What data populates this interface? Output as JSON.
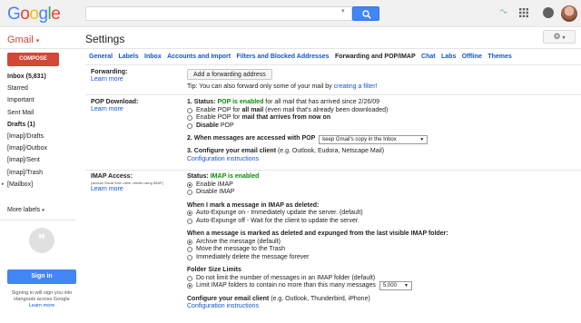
{
  "header": {
    "logo_letters": [
      {
        "ch": "G",
        "color": "#4285f4"
      },
      {
        "ch": "o",
        "color": "#ea4335"
      },
      {
        "ch": "o",
        "color": "#fbbc05"
      },
      {
        "ch": "g",
        "color": "#4285f4"
      },
      {
        "ch": "l",
        "color": "#34a853"
      },
      {
        "ch": "e",
        "color": "#ea4335"
      }
    ],
    "search": {
      "value": "",
      "placeholder": ""
    },
    "icons": [
      "apps-icon",
      "notifications-icon",
      "avatar"
    ]
  },
  "app": {
    "label": "Gmail",
    "page_title": "Settings",
    "gear_label": "⚙"
  },
  "sidebar": {
    "compose": "COMPOSE",
    "items": [
      {
        "label": "Inbox (5,831)",
        "bold": true
      },
      {
        "label": "Starred"
      },
      {
        "label": "Important"
      },
      {
        "label": "Sent Mail"
      },
      {
        "label": "Drafts (1)",
        "bold": true
      },
      {
        "label": "[Imap]/Drafts"
      },
      {
        "label": "[Imap]/Outbox"
      },
      {
        "label": "[Imap]/Sent"
      },
      {
        "label": "[Imap]/Trash"
      },
      {
        "label": "[Mailbox]",
        "arrow": true
      }
    ],
    "more_labels": "More labels",
    "hangouts_glyph": "❞",
    "signin": "Sign in",
    "signin_note": "Signing in will sign you into Hangouts across Google",
    "learn_more": "Learn more"
  },
  "tabs": [
    {
      "label": "General"
    },
    {
      "label": "Labels"
    },
    {
      "label": "Inbox"
    },
    {
      "label": "Accounts and Import"
    },
    {
      "label": "Filters and Blocked Addresses"
    },
    {
      "label": "Forwarding and POP/IMAP",
      "active": true
    },
    {
      "label": "Chat"
    },
    {
      "label": "Labs"
    },
    {
      "label": "Offline"
    },
    {
      "label": "Themes"
    }
  ],
  "forwarding": {
    "label": "Forwarding:",
    "learn_more": "Learn more",
    "button": "Add a forwarding address",
    "tip_prefix": "Tip: You can also forward only some of your mail by ",
    "tip_link": "creating a filter!"
  },
  "pop": {
    "label": "POP Download:",
    "learn_more": "Learn more",
    "status_prefix": "1. Status: ",
    "status_value": "POP is enabled",
    "status_suffix": " for all mail that has arrived since 2/26/09",
    "options": [
      {
        "pre": "Enable POP for ",
        "bold": "all mail",
        "post": " (even mail that's already been downloaded)",
        "checked": false
      },
      {
        "pre": "Enable POP for ",
        "bold": "mail that arrives from now on",
        "post": "",
        "checked": false
      },
      {
        "pre": "",
        "bold": "Disable",
        "post": " POP",
        "checked": false
      }
    ],
    "step2": "2. When messages are accessed with POP",
    "step2_select": "keep Gmail's copy in the Inbox",
    "step3_bold": "3. Configure your email client",
    "step3_rest": " (e.g. Outlook, Eudora, Netscape Mail)",
    "config_link": "Configuration instructions"
  },
  "imap": {
    "label": "IMAP Access:",
    "sublabel": "(access Gmail from other clients using IMAP)",
    "learn_more": "Learn more",
    "status_prefix": "Status: ",
    "status_value": "IMAP is enabled",
    "access_options": [
      {
        "label": "Enable IMAP",
        "checked": true
      },
      {
        "label": "Disable IMAP",
        "checked": false
      }
    ],
    "deleted_title": "When I mark a message in IMAP as deleted:",
    "deleted_options": [
      {
        "label": "Auto-Expunge on - Immediately update the server. (default)",
        "checked": true
      },
      {
        "label": "Auto-Expunge off - Wait for the client to update the server.",
        "checked": false
      }
    ],
    "expunged_title": "When a message is marked as deleted and expunged from the last visible IMAP folder:",
    "expunged_options": [
      {
        "label": "Archive the message (default)",
        "checked": true
      },
      {
        "label": "Move the message to the Trash",
        "checked": false
      },
      {
        "label": "Immediately delete the message forever",
        "checked": false
      }
    ],
    "folder_title": "Folder Size Limits",
    "folder_options": [
      {
        "label": "Do not limit the number of messages in an IMAP folder (default)",
        "checked": false
      },
      {
        "label": "Limit IMAP folders to contain no more than this many messages",
        "checked": true
      }
    ],
    "folder_select": "5,000",
    "client_bold": "Configure your email client",
    "client_rest": " (e.g. Outlook, Thunderbird, iPhone)",
    "config_link": "Configuration instructions"
  }
}
